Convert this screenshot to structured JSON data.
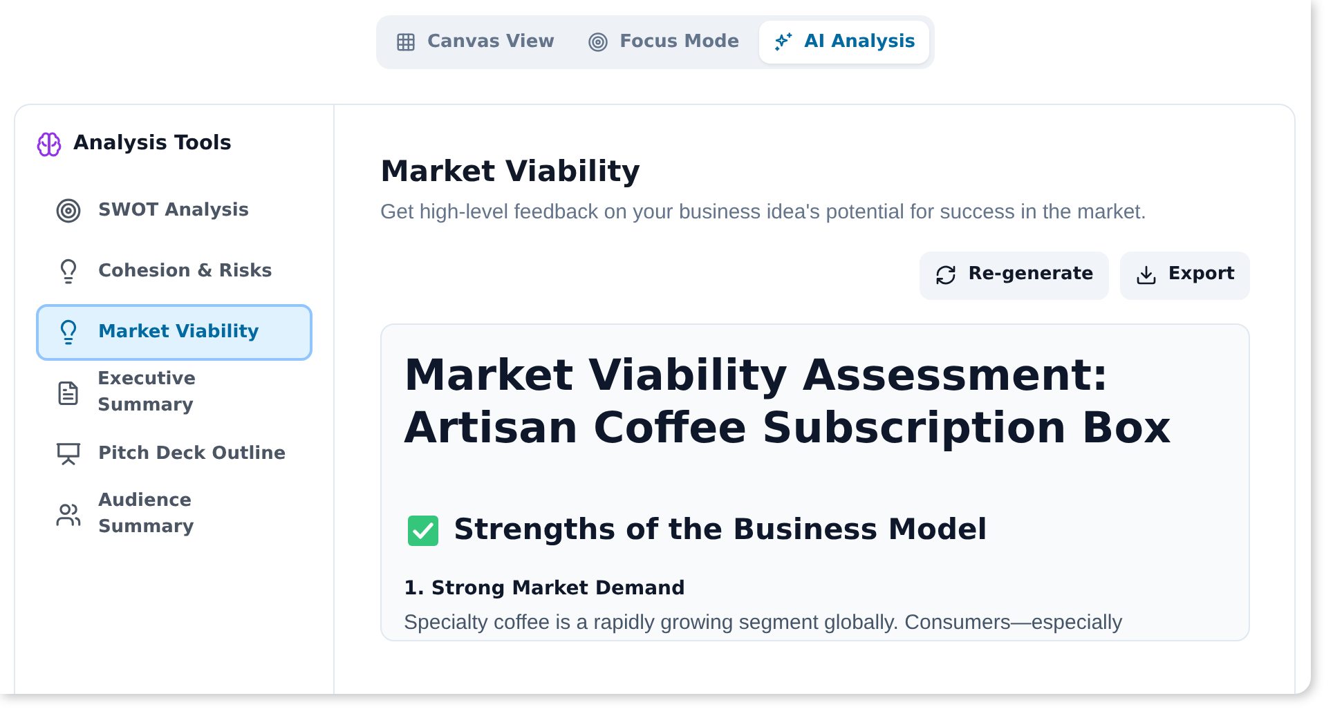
{
  "view_tabs": [
    {
      "label": "Canvas View",
      "selected": false
    },
    {
      "label": "Focus Mode",
      "selected": false
    },
    {
      "label": "AI Analysis",
      "selected": true
    }
  ],
  "sidebar": {
    "title": "Analysis Tools",
    "items": [
      {
        "label": "SWOT Analysis",
        "selected": false
      },
      {
        "label": "Cohesion & Risks",
        "selected": false
      },
      {
        "label": "Market Viability",
        "selected": true
      },
      {
        "label": "Executive Summary",
        "selected": false
      },
      {
        "label": "Pitch Deck Outline",
        "selected": false
      },
      {
        "label": "Audience Summary",
        "selected": false
      }
    ]
  },
  "content": {
    "title": "Market Viability",
    "subtitle": "Get high-level feedback on your business idea's potential for success in the market.",
    "buttons": [
      "Re-generate",
      "Export"
    ],
    "report": {
      "title": "Market Viability Assessment: Artisan Coffee Subscription Box",
      "section_heading": "Strengths of the Business Model",
      "point_heading": "1. Strong Market Demand",
      "paragraph": "Specialty coffee is a rapidly growing segment globally. Consumers—especially"
    }
  }
}
